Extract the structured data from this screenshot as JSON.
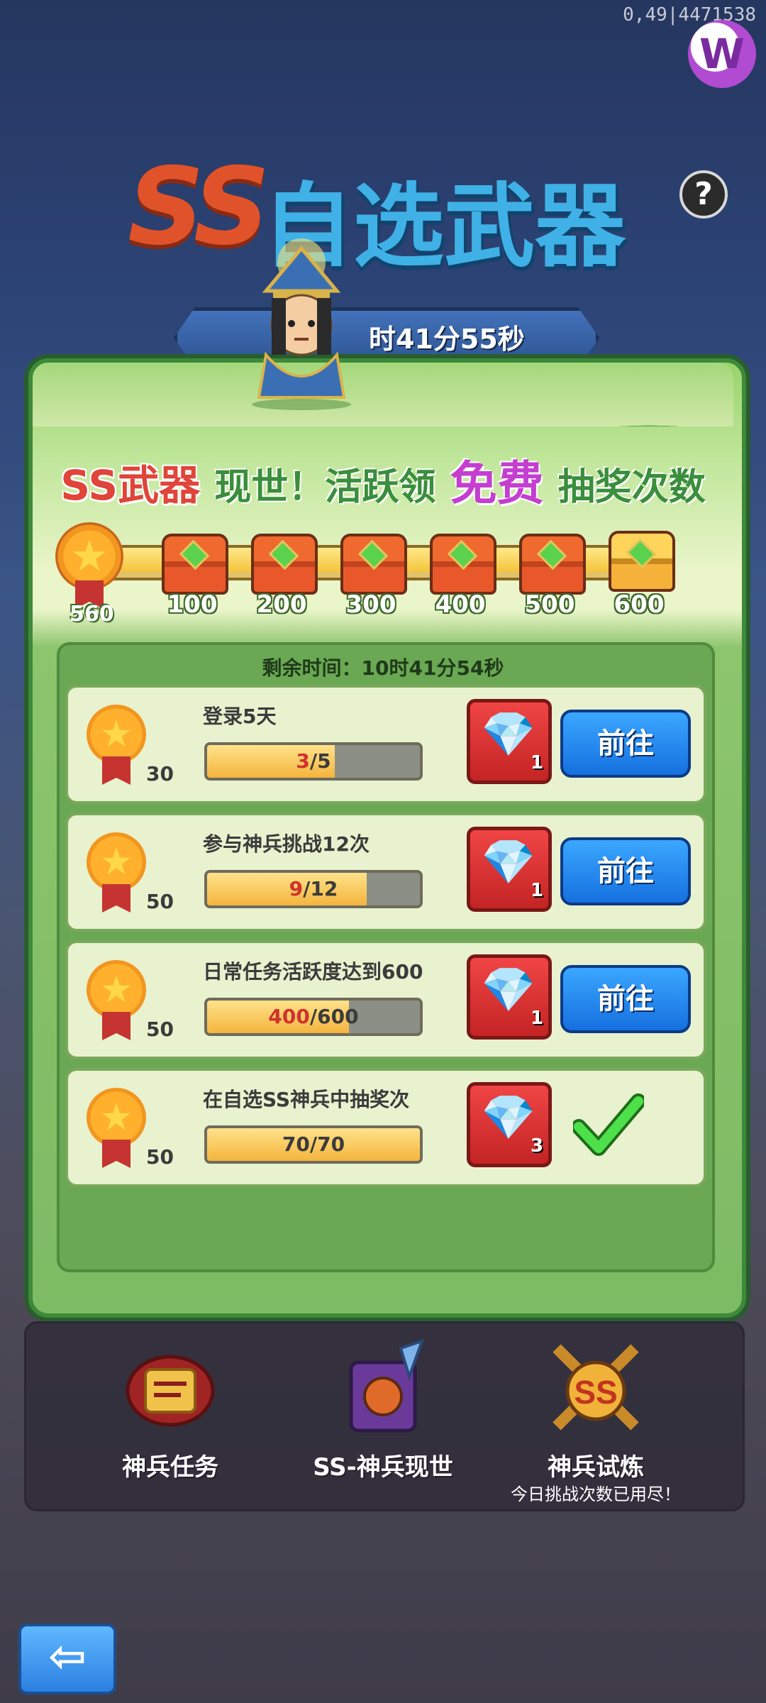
{
  "status": {
    "text": "0,49|4471538"
  },
  "header": {
    "title_ss": "SS",
    "title_main": "自选武器",
    "timer": "时41分55秒",
    "help_label": "?"
  },
  "slogan": {
    "part1": "SS武器",
    "part2": "现世！活跃领",
    "part3": "免费",
    "part4": "抽奖次数"
  },
  "progress": {
    "current": "560",
    "value": 560,
    "max": 600,
    "milestones": [
      "100",
      "200",
      "300",
      "400",
      "500",
      "600"
    ]
  },
  "tasks_panel": {
    "remaining": "剩余时间：10时41分54秒",
    "tasks": [
      {
        "title": "登录5天",
        "points": "30",
        "current": "3",
        "total": "/5",
        "fraction": 0.6,
        "reward_count": "1",
        "action": "前往",
        "completed": false
      },
      {
        "title": "参与神兵挑战12次",
        "points": "50",
        "current": "9",
        "total": "/12",
        "fraction": 0.75,
        "reward_count": "1",
        "action": "前往",
        "completed": false
      },
      {
        "title": "日常任务活跃度达到600",
        "points": "50",
        "current": "400",
        "total": "/600",
        "fraction": 0.667,
        "reward_count": "1",
        "action": "前往",
        "completed": false
      },
      {
        "title": "在自选SS神兵中抽奖次",
        "points": "50",
        "current": "70",
        "total": "/70",
        "fraction": 1.0,
        "reward_count": "3",
        "action": "",
        "completed": true
      }
    ]
  },
  "bottom_tabs": {
    "tab1": {
      "label": "神兵任务",
      "icon": "scroll-icon"
    },
    "tab2": {
      "label": "SS-神兵现世",
      "icon": "weapon-book-icon"
    },
    "tab3": {
      "label": "神兵试炼",
      "sub": "今日挑战次数已用尽！",
      "icon": "ss-swords-icon"
    }
  },
  "nav": {
    "back_icon": "back-arrow-icon"
  },
  "colors": {
    "go_button": "#1f86ee",
    "reward_bg": "#d83232",
    "panel": "#8cc56c",
    "accent_red": "#d0312d"
  }
}
